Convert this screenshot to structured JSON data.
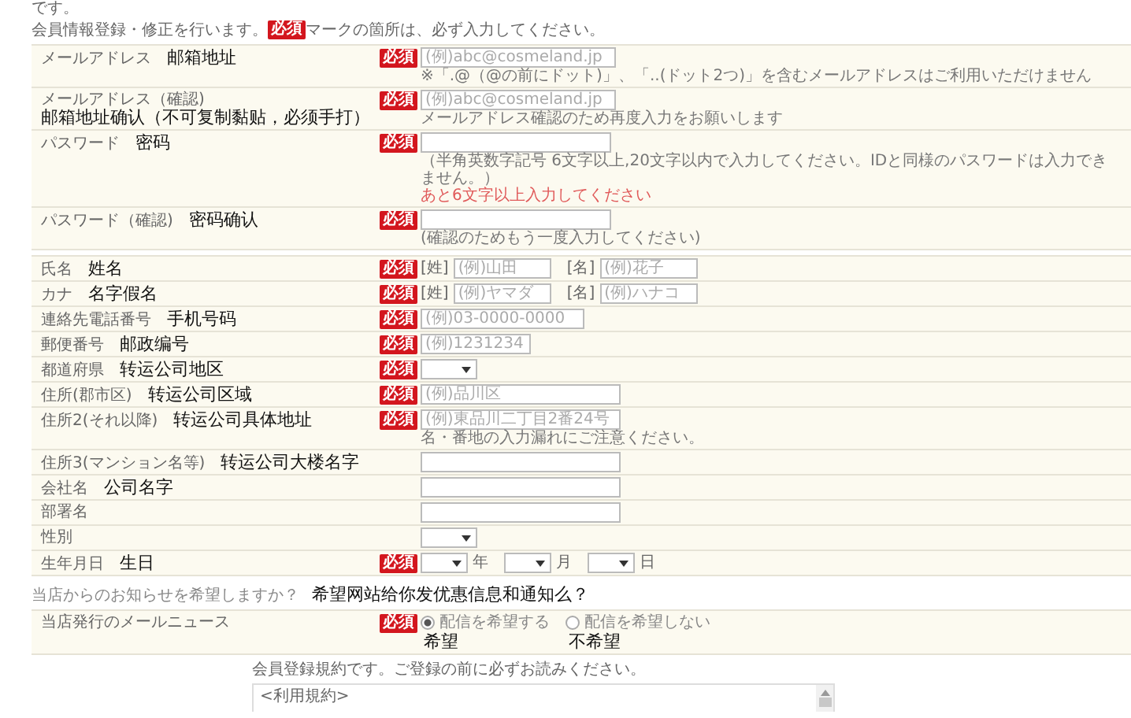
{
  "top_fragment": "です。",
  "intro": {
    "before": "会員情報登録・修正を行います。",
    "badge": "必須",
    "after": "マークの箇所は、必ず入力してください。"
  },
  "account_rows": [
    {
      "label": "メールアドレス",
      "annotation": "邮箱地址",
      "badge": "必須",
      "fields": [
        {
          "kind": "email",
          "placeholder": "(例)abc@cosmeland.jp"
        }
      ],
      "notes": [
        {
          "kind": "hint",
          "text": "※「.@（@の前にドット)」、「..(ドット2つ)」を含むメールアドレスはご利用いただけません"
        }
      ]
    },
    {
      "label": "メールアドレス（確認)",
      "annotation": "邮箱地址确认（不可复制黏贴，必须手打）",
      "badge": "必須",
      "fields": [
        {
          "kind": "email",
          "placeholder": "(例)abc@cosmeland.jp"
        }
      ],
      "notes": [
        {
          "kind": "hint",
          "text": "メールアドレス確認のため再度入力をお願いします"
        }
      ]
    },
    {
      "label": "パスワード",
      "annotation": "密码",
      "badge": "必須",
      "fields": [
        {
          "kind": "password"
        }
      ],
      "notes": [
        {
          "kind": "hint",
          "text": "（半角英数字記号 6文字以上,20文字以内で入力してください。IDと同様のパスワードは入力できません。）"
        },
        {
          "kind": "error",
          "text": "あと6文字以上入力してください"
        }
      ]
    },
    {
      "label": "パスワード（確認)",
      "annotation": "密码确认",
      "badge": "必須",
      "fields": [
        {
          "kind": "password"
        }
      ],
      "notes": [
        {
          "kind": "hint",
          "text": "(確認のためもう一度入力してください)"
        }
      ]
    }
  ],
  "profile_rows": [
    {
      "label": "氏名",
      "annotation": "姓名",
      "badge": "必須",
      "fields": [
        {
          "kind": "name",
          "prefix": "[姓]",
          "placeholder": "(例)山田"
        },
        {
          "kind": "name",
          "prefix": "[名]",
          "placeholder": "(例)花子"
        }
      ]
    },
    {
      "label": "カナ",
      "annotation": "名字假名",
      "badge": "必須",
      "fields": [
        {
          "kind": "name",
          "prefix": "[姓]",
          "placeholder": "(例)ヤマダ"
        },
        {
          "kind": "name",
          "prefix": "[名]",
          "placeholder": "(例)ハナコ"
        }
      ]
    },
    {
      "label": "連絡先電話番号",
      "annotation": "手机号码",
      "badge": "必須",
      "fields": [
        {
          "kind": "tel",
          "placeholder": "(例)03-0000-0000"
        }
      ]
    },
    {
      "label": "郵便番号",
      "annotation": "邮政编号",
      "badge": "必須",
      "fields": [
        {
          "kind": "postal",
          "placeholder": "(例)1231234"
        }
      ]
    },
    {
      "label": "都道府県",
      "annotation": "转运公司地区",
      "badge": "必須",
      "fields": [
        {
          "kind": "select"
        }
      ]
    },
    {
      "label": "住所(郡市区)",
      "annotation": "转运公司区域",
      "badge": "必須",
      "fields": [
        {
          "kind": "address",
          "placeholder": "(例)品川区"
        }
      ]
    },
    {
      "label": "住所2(それ以降)",
      "annotation": "转运公司具体地址",
      "badge": "必須",
      "fields": [
        {
          "kind": "address",
          "placeholder": "(例)東品川二丁目2番24号"
        }
      ],
      "notes": [
        {
          "kind": "hint",
          "text": "名・番地の入力漏れにご注意ください。"
        }
      ]
    },
    {
      "label": "住所3(マンション名等)",
      "annotation": "转运公司大楼名字",
      "fields": [
        {
          "kind": "address"
        }
      ]
    },
    {
      "label": "会社名",
      "annotation": "公司名字",
      "fields": [
        {
          "kind": "address"
        }
      ]
    },
    {
      "label": "部署名",
      "fields": [
        {
          "kind": "address"
        }
      ]
    },
    {
      "label": "性別",
      "fields": [
        {
          "kind": "select"
        }
      ]
    },
    {
      "label": "生年月日",
      "annotation": "生日",
      "badge": "必須",
      "fields": [
        {
          "kind": "date-part",
          "suffix": "年"
        },
        {
          "kind": "date-part",
          "suffix": "月"
        },
        {
          "kind": "date-part",
          "suffix": "日"
        }
      ]
    }
  ],
  "question": {
    "text": "当店からのお知らせを希望しますか？",
    "annotation": "希望网站给你发优惠信息和通知么？"
  },
  "newsletter_rows": [
    {
      "label": "当店発行のメールニュース",
      "badge": "必須",
      "options": [
        {
          "label": "配信を希望する",
          "selected": true,
          "annotation": "希望"
        },
        {
          "label": "配信を希望しない",
          "selected": false,
          "annotation": "不希望"
        }
      ]
    }
  ],
  "terms": {
    "intro": "会員登録規約です。ご登録の前に必ずお読みください。",
    "heading": "<利用規約>"
  }
}
